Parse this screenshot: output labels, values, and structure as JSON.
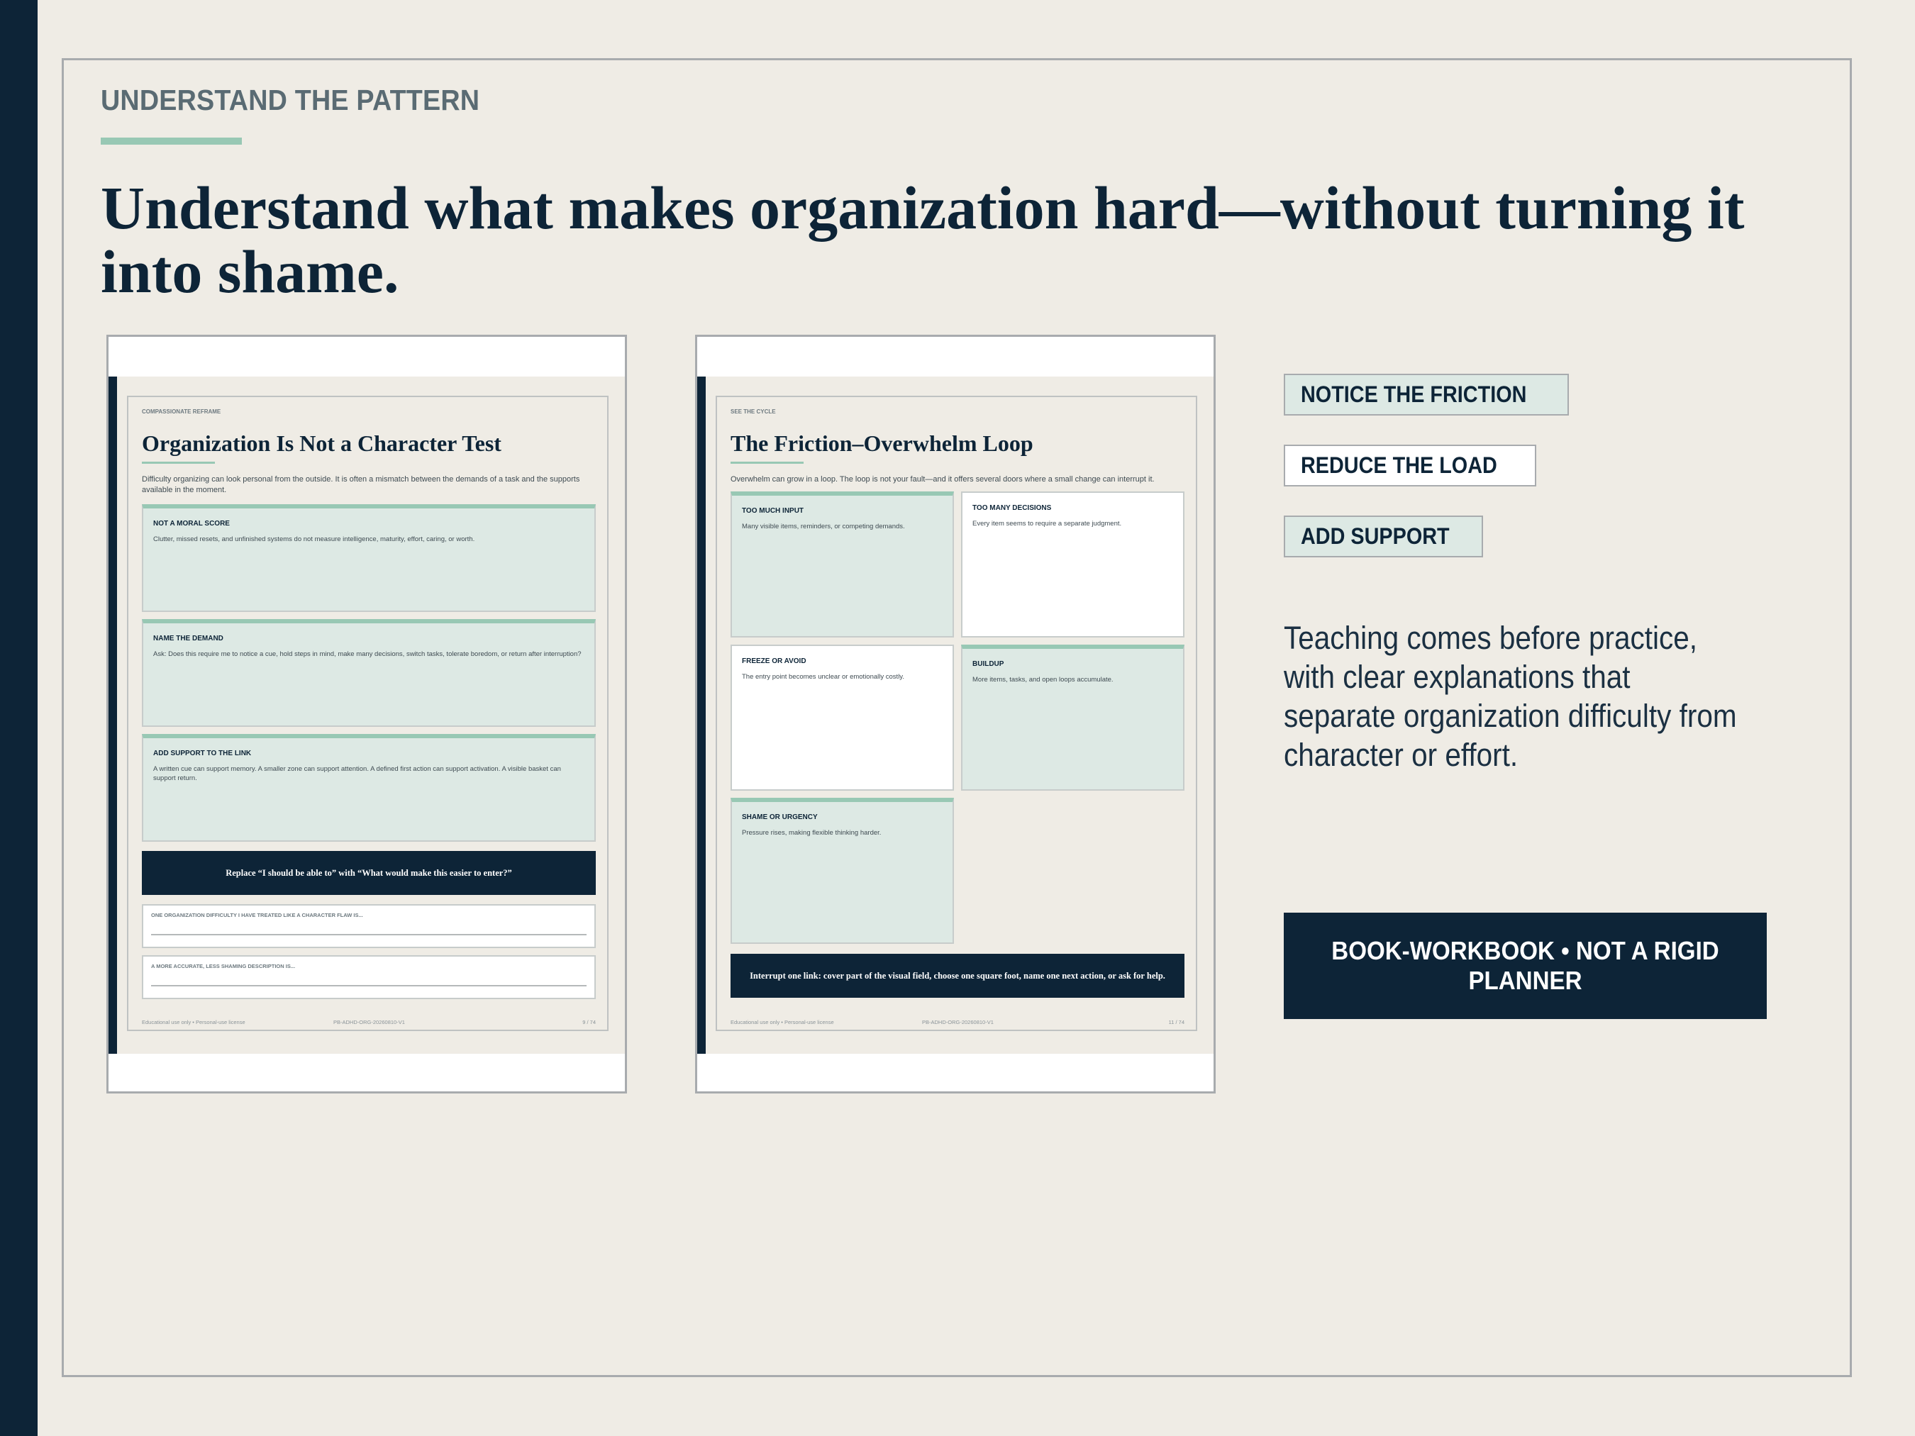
{
  "slide": {
    "eyebrow": "UNDERSTAND THE PATTERN",
    "headline": "Understand what makes organization hard—without turning it into shame."
  },
  "page_left": {
    "eyebrow": "COMPASSIONATE REFRAME",
    "title": "Organization Is Not a Character Test",
    "intro": "Difficulty organizing can look personal from the outside. It is often a mismatch between the demands of a task and the supports available in the moment.",
    "cards": [
      {
        "title": "NOT A MORAL SCORE",
        "text": "Clutter, missed resets, and unfinished systems do not measure intelligence, maturity, effort, caring, or worth."
      },
      {
        "title": "NAME THE DEMAND",
        "text": "Ask: Does this require me to notice a cue, hold steps in mind, make many decisions, switch tasks, tolerate boredom, or return after interruption?"
      },
      {
        "title": "ADD SUPPORT TO THE LINK",
        "text": "A written cue can support memory. A smaller zone can support attention. A defined first action can support activation. A visible basket can support return."
      }
    ],
    "banner": "Replace “I should be able to” with “What would make this easier to enter?”",
    "prompts": [
      "ONE ORGANIZATION DIFFICULTY I HAVE TREATED LIKE A CHARACTER FLAW IS...",
      "A MORE ACCURATE, LESS SHAMING DESCRIPTION IS..."
    ],
    "footer": {
      "license": "Educational use only • Personal-use license",
      "code": "PB-ADHD-ORG-20260810-V1",
      "page": "9 / 74"
    }
  },
  "page_right": {
    "eyebrow": "SEE THE CYCLE",
    "title": "The Friction–Overwhelm Loop",
    "intro": "Overwhelm can grow in a loop. The loop is not your fault—and it offers several doors where a small change can interrupt it.",
    "cards": [
      {
        "title": "TOO MUCH INPUT",
        "text": "Many visible items, reminders, or competing demands."
      },
      {
        "title": "TOO MANY DECISIONS",
        "text": "Every item seems to require a separate judgment."
      },
      {
        "title": "FREEZE OR AVOID",
        "text": "The entry point becomes unclear or emotionally costly."
      },
      {
        "title": "BUILDUP",
        "text": "More items, tasks, and open loops accumulate."
      },
      {
        "title": "SHAME OR URGENCY",
        "text": "Pressure rises, making flexible thinking harder."
      }
    ],
    "banner": "Interrupt one link: cover part of the visual field, choose one square foot, name one next action, or ask for help.",
    "footer": {
      "license": "Educational use only • Personal-use license",
      "code": "PB-ADHD-ORG-20260810-V1",
      "page": "11 / 74"
    }
  },
  "chips": [
    "NOTICE THE FRICTION",
    "REDUCE THE LOAD",
    "ADD SUPPORT"
  ],
  "side_copy": "Teaching comes before practice, with clear explanations that separate organization difficulty from character or effort.",
  "cta": "BOOK-WORKBOOK • NOT A RIGID PLANNER",
  "colors": {
    "navy": "#0d2437",
    "mint": "#98c8b4",
    "mint_tint": "#dde9e4",
    "paper": "#efece5",
    "frame_gray": "#a8abae"
  }
}
